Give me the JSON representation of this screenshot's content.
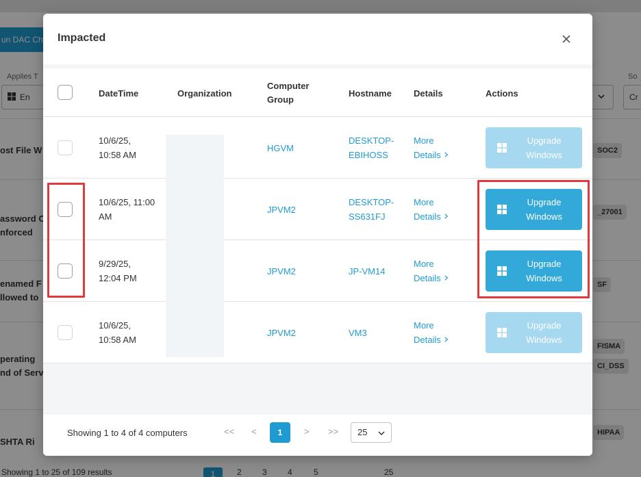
{
  "background": {
    "run_button": "un DAC Ch",
    "applies_label": "Applies T",
    "applies_value": "En",
    "so_label": "So",
    "cr_value": "Cr",
    "rows": [
      {
        "text": "ost File W"
      },
      {
        "text": "assword C\nnforced"
      },
      {
        "text": "enamed F\nllowed to"
      },
      {
        "text": "perating\nnd of Serv"
      },
      {
        "text": "SHTA Ri"
      }
    ],
    "tags": [
      "SOC2",
      "_27001",
      "SF",
      "FISMA",
      "CI_DSS",
      "HIPAA"
    ],
    "pagination_text": "Showing 1 to 25 of 109 results",
    "pages": [
      "1",
      "2",
      "3",
      "4",
      "5"
    ],
    "per_page": "25"
  },
  "modal": {
    "title": "Impacted",
    "columns": {
      "datetime": "DateTime",
      "organization": "Organization",
      "computer_group_1": "Computer",
      "computer_group_2": "Group",
      "hostname": "Hostname",
      "details": "Details",
      "actions": "Actions"
    },
    "rows": [
      {
        "date_1": "10/6/25,",
        "date_2": "10:58 AM",
        "group": "HGVM",
        "host_1": "DESKTOP-",
        "host_2": "EBIHOSS",
        "details_1": "More",
        "details_2": "Details",
        "action_1": "Upgrade",
        "action_2": "Windows",
        "enabled": false
      },
      {
        "date_1": "10/6/25, 11:00",
        "date_2": "AM",
        "group": "JPVM2",
        "host_1": "DESKTOP-",
        "host_2": "SS631FJ",
        "details_1": "More",
        "details_2": "Details",
        "action_1": "Upgrade",
        "action_2": "Windows",
        "enabled": true
      },
      {
        "date_1": "9/29/25,",
        "date_2": "12:04 PM",
        "group": "JPVM2",
        "host_1": "JP-VM14",
        "host_2": "",
        "details_1": "More",
        "details_2": "Details",
        "action_1": "Upgrade",
        "action_2": "Windows",
        "enabled": true
      },
      {
        "date_1": "10/6/25,",
        "date_2": "10:58 AM",
        "group": "JPVM2",
        "host_1": "VM3",
        "host_2": "",
        "details_1": "More",
        "details_2": "Details",
        "action_1": "Upgrade",
        "action_2": "Windows",
        "enabled": false
      }
    ],
    "footer": {
      "showing": "Showing 1 to 4 of 4 computers",
      "first": "<<",
      "prev": "<",
      "current_page": "1",
      "next": ">",
      "last": ">>",
      "per_page": "25"
    }
  },
  "colors": {
    "accent": "#1f9bd1",
    "button": "#33a9d9",
    "button_disabled": "#a6d8ef",
    "annotation": "#e0393e"
  }
}
